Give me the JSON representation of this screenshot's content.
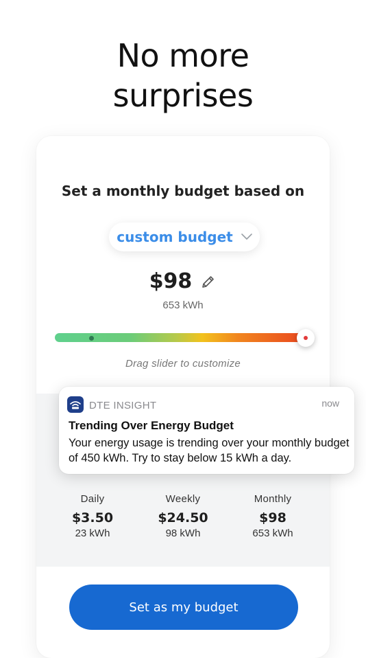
{
  "headline": {
    "line1": "No more",
    "line2": "surprises"
  },
  "budget": {
    "prompt": "Set a monthly budget based on",
    "selected_option": "custom budget",
    "amount": "$98",
    "kwh": "653 kWh",
    "slider_caption": "Drag slider to customize",
    "slider_level": 1.0
  },
  "notification": {
    "app_name": "DTE INSIGHT",
    "time": "now",
    "title": "Trending Over Energy Budget",
    "body": "Your energy usage is trending over your monthly budget of 450 kWh. Try to stay below 15 kWh a day."
  },
  "stats": [
    {
      "label": "Daily",
      "value": "$3.50",
      "kwh": "23 kWh"
    },
    {
      "label": "Weekly",
      "value": "$24.50",
      "kwh": "98 kWh"
    },
    {
      "label": "Monthly",
      "value": "$98",
      "kwh": "653 kWh"
    }
  ],
  "cta": {
    "label": "Set as my budget"
  },
  "colors": {
    "accent": "#1769d1",
    "link": "#3b8de8",
    "notif_icon": "#1f3f8a"
  },
  "icons": {
    "dropdown": "chevron-down-icon",
    "edit": "pencil-icon",
    "app": "dte-insight-app-icon"
  }
}
